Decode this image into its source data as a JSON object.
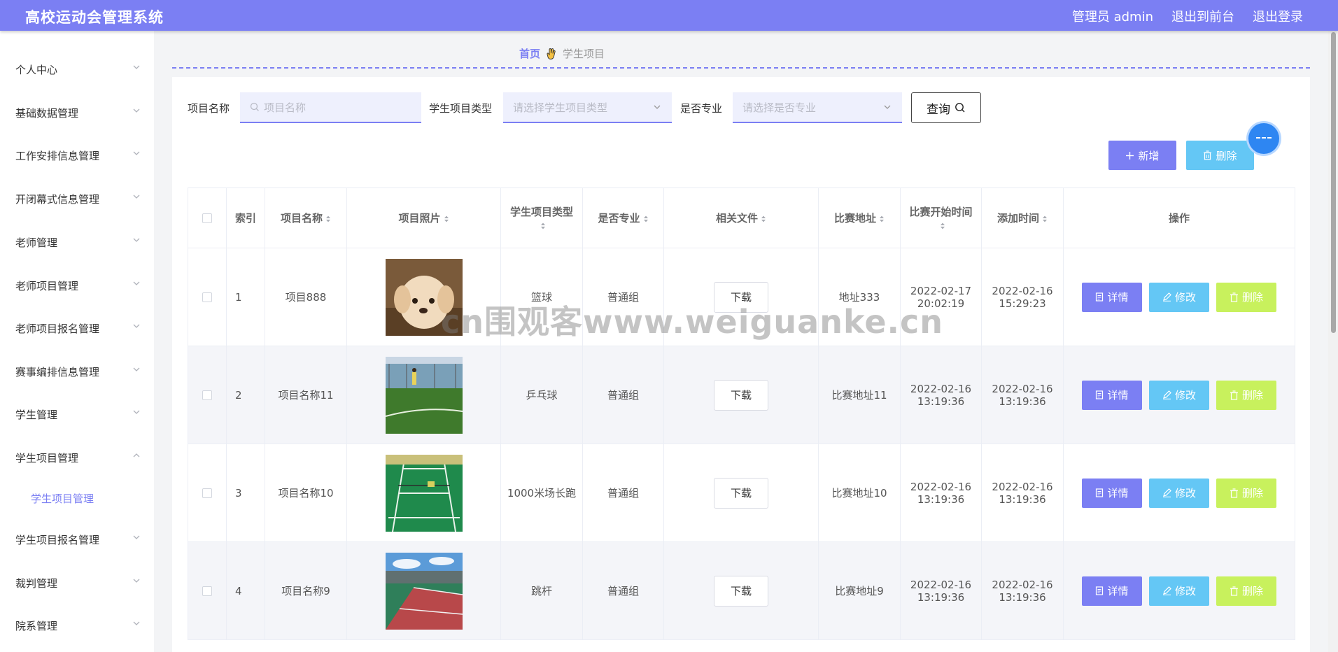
{
  "header": {
    "title": "高校运动会管理系统",
    "admin_label": "管理员 admin",
    "back_to_front": "退出到前台",
    "logout": "退出登录"
  },
  "sidebar": {
    "items": [
      {
        "label": "个人中心"
      },
      {
        "label": "基础数据管理"
      },
      {
        "label": "工作安排信息管理"
      },
      {
        "label": "开闭幕式信息管理"
      },
      {
        "label": "老师管理"
      },
      {
        "label": "老师项目管理"
      },
      {
        "label": "老师项目报名管理"
      },
      {
        "label": "赛事编排信息管理"
      },
      {
        "label": "学生管理"
      },
      {
        "label": "学生项目管理",
        "expanded": true,
        "children": [
          {
            "label": "学生项目管理",
            "active": true
          }
        ]
      },
      {
        "label": "学生项目报名管理"
      },
      {
        "label": "裁判管理"
      },
      {
        "label": "院系管理"
      }
    ]
  },
  "breadcrumb": {
    "home": "首页",
    "current": "学生项目"
  },
  "filters": {
    "name_label": "项目名称",
    "name_placeholder": "项目名称",
    "type_label": "学生项目类型",
    "type_placeholder": "请选择学生项目类型",
    "pro_label": "是否专业",
    "pro_placeholder": "请选择是否专业",
    "query_label": "查询"
  },
  "actions": {
    "add_label": "新增",
    "delete_label": "删除"
  },
  "table": {
    "columns": [
      "索引",
      "项目名称",
      "项目照片",
      "学生项目类型",
      "是否专业",
      "相关文件",
      "比赛地址",
      "比赛开始时间",
      "添加时间",
      "操作"
    ],
    "download_label": "下载",
    "op_detail": "详情",
    "op_edit": "修改",
    "op_delete": "删除",
    "rows": [
      {
        "index": "1",
        "name": "项目888",
        "photo": "puppy",
        "type": "篮球",
        "pro": "普通组",
        "address": "地址333",
        "start": "2022-02-17 20:02:19",
        "added": "2022-02-16 15:29:23"
      },
      {
        "index": "2",
        "name": "项目名称11",
        "photo": "soccer-field",
        "type": "乒乓球",
        "pro": "普通组",
        "address": "比赛地址11",
        "start": "2022-02-16 13:19:36",
        "added": "2022-02-16 13:19:36"
      },
      {
        "index": "3",
        "name": "项目名称10",
        "photo": "badminton-court",
        "type": "1000米场长跑",
        "pro": "普通组",
        "address": "比赛地址10",
        "start": "2022-02-16 13:19:36",
        "added": "2022-02-16 13:19:36"
      },
      {
        "index": "4",
        "name": "项目名称9",
        "photo": "sports-court",
        "type": "跳杆",
        "pro": "普通组",
        "address": "比赛地址9",
        "start": "2022-02-16 13:19:36",
        "added": "2022-02-16 13:19:36"
      }
    ]
  },
  "watermark": "cn围观客www.weiguanke.cn",
  "colors": {
    "primary": "#7b7ff3",
    "info": "#64c7f5",
    "warning": "#c8f15d"
  }
}
